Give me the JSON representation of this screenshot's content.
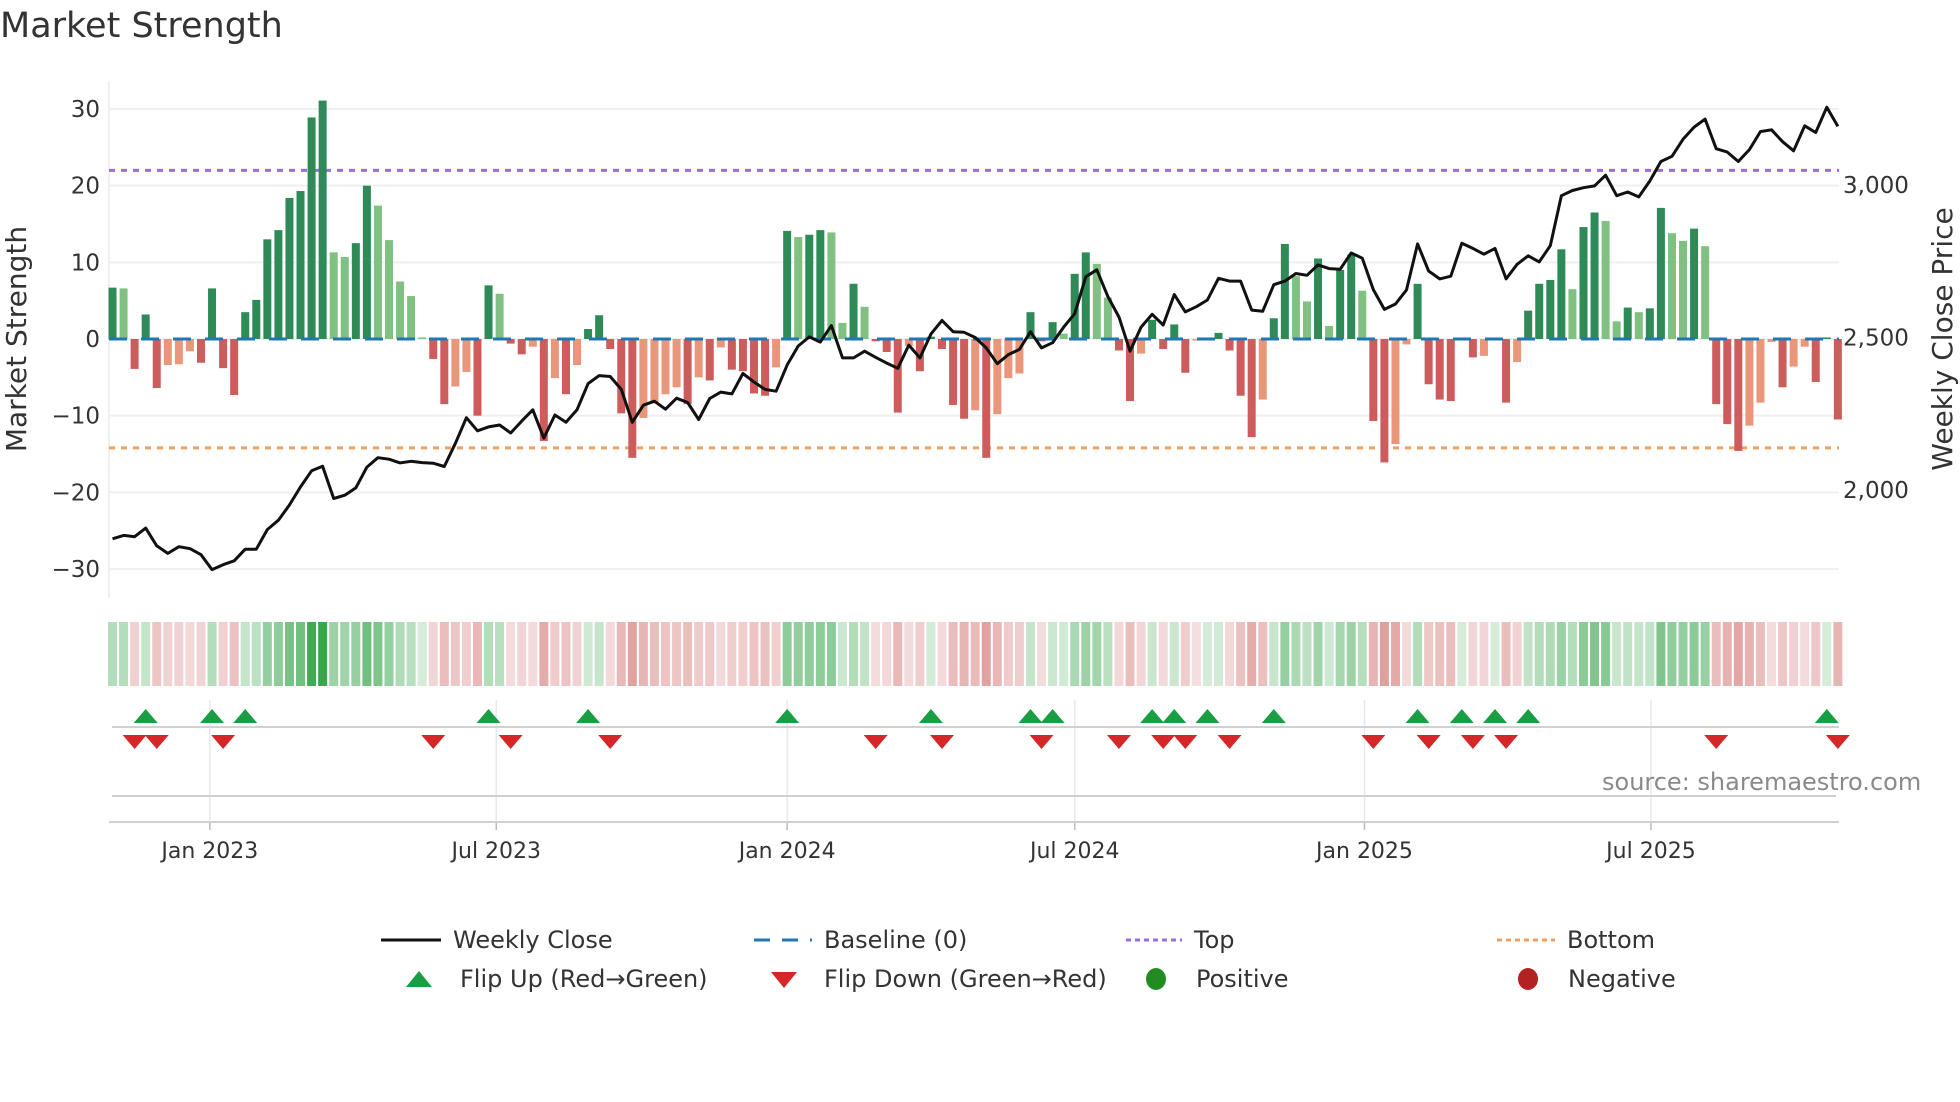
{
  "title": "Market Strength",
  "source": "source: sharemaestro.com",
  "legend": {
    "weekly_close": "Weekly Close",
    "baseline": "Baseline (0)",
    "top": "Top",
    "bottom": "Bottom",
    "flip_up": "Flip Up (Red→Green)",
    "flip_down": "Flip Down (Green→Red)",
    "positive": "Positive",
    "negative": "Negative"
  },
  "colors": {
    "green_dark": "#2e8b57",
    "green_light": "#80c080",
    "red_dark": "#cd5c5c",
    "red_light": "#e9967a",
    "baseline": "#1f77b4",
    "top": "#9b6ddb",
    "bottom": "#f0a060",
    "flip_up": "#1a9e44",
    "flip_down": "#d62728",
    "positive": "#228b22",
    "negative": "#b22222"
  },
  "chart_data": {
    "type": "bar",
    "title": "Market Strength",
    "ylabel": "Market Strength",
    "y2label": "Weekly Close Price",
    "ylim": [
      -33.5,
      33.5
    ],
    "yticks": [
      30,
      20,
      10,
      0,
      -10,
      -20,
      -30
    ],
    "yticklabels": [
      "30",
      "20",
      "10",
      "0",
      "−10",
      "−20",
      "−30"
    ],
    "y2ticks": [
      3000,
      2500,
      2000
    ],
    "y2ticklabels": [
      "3,000",
      "2,500",
      "2,000"
    ],
    "top_level": 22.0,
    "bottom_level": -14.2,
    "baseline": 0,
    "x_unit": "week index",
    "xticks": [
      9.8,
      35.7,
      62.0,
      88.0,
      114.2,
      140.1
    ],
    "xticklabels": [
      "Jan 2023",
      "Jul 2023",
      "Jan 2024",
      "Jul 2024",
      "Jan 2025",
      "Jul 2025"
    ],
    "strength": [
      6.7,
      6.6,
      -3.9,
      3.2,
      -6.4,
      -3.4,
      -3.3,
      -1.6,
      -3.1,
      6.6,
      -3.8,
      -7.3,
      3.5,
      5.1,
      13.0,
      14.2,
      18.4,
      19.3,
      28.9,
      31.1,
      11.3,
      10.7,
      12.5,
      20.0,
      17.4,
      12.9,
      7.5,
      5.6,
      0.2,
      -2.6,
      -8.5,
      -6.2,
      -4.3,
      -10.0,
      7.0,
      5.9,
      -0.6,
      -2.0,
      -1.0,
      -13.3,
      -5.1,
      -7.2,
      -3.4,
      1.3,
      3.1,
      -1.3,
      -9.7,
      -15.5,
      -10.3,
      -8.4,
      -7.2,
      -6.3,
      -8.5,
      -5.0,
      -5.4,
      -1.1,
      -4.0,
      -4.2,
      -7.1,
      -7.4,
      -3.7,
      14.1,
      13.3,
      13.6,
      14.2,
      13.9,
      2.1,
      7.2,
      4.2,
      -0.3,
      -1.7,
      -9.6,
      -0.9,
      -4.2,
      0.3,
      -1.3,
      -8.6,
      -10.4,
      -9.3,
      -15.5,
      -9.8,
      -5.1,
      -4.5,
      3.5,
      -0.3,
      2.2,
      0.7,
      8.5,
      11.3,
      9.8,
      5.4,
      -1.5,
      -8.1,
      -1.9,
      2.5,
      -1.3,
      1.9,
      -4.4,
      -0.2,
      0.2,
      0.8,
      -1.5,
      -7.4,
      -12.8,
      -7.9,
      2.7,
      12.4,
      8.2,
      4.9,
      10.5,
      1.7,
      9.0,
      11.0,
      6.3,
      -10.7,
      -16.1,
      -13.7,
      -0.7,
      7.2,
      -5.9,
      -7.9,
      -8.1,
      0.2,
      -2.4,
      -2.2,
      0.2,
      -8.3,
      -3.0,
      3.7,
      7.2,
      7.7,
      11.7,
      6.5,
      14.6,
      16.5,
      15.4,
      2.3,
      4.1,
      3.5,
      4.0,
      17.1,
      13.8,
      12.8,
      14.4,
      12.1,
      -8.5,
      -11.1,
      -14.6,
      -11.3,
      -8.3,
      -0.4,
      -6.3,
      -3.6,
      -1.0,
      -5.6,
      0.2,
      -10.5
    ],
    "weekly_close": [
      1840,
      1851,
      1847,
      1875,
      1817,
      1792,
      1814,
      1808,
      1788,
      1739,
      1755,
      1768,
      1806,
      1806,
      1870,
      1901,
      1951,
      2010,
      2063,
      2078,
      1972,
      1983,
      2007,
      2075,
      2106,
      2101,
      2089,
      2094,
      2090,
      2088,
      2077,
      2153,
      2237,
      2194,
      2207,
      2213,
      2187,
      2226,
      2263,
      2170,
      2246,
      2222,
      2263,
      2349,
      2375,
      2372,
      2330,
      2222,
      2278,
      2291,
      2265,
      2301,
      2287,
      2231,
      2300,
      2321,
      2315,
      2382,
      2354,
      2330,
      2324,
      2410,
      2472,
      2502,
      2485,
      2539,
      2433,
      2433,
      2455,
      2435,
      2416,
      2399,
      2475,
      2433,
      2511,
      2556,
      2519,
      2517,
      2500,
      2466,
      2414,
      2444,
      2461,
      2519,
      2466,
      2483,
      2534,
      2578,
      2699,
      2722,
      2634,
      2567,
      2455,
      2534,
      2576,
      2541,
      2641,
      2584,
      2601,
      2623,
      2694,
      2685,
      2685,
      2590,
      2586,
      2673,
      2685,
      2710,
      2704,
      2738,
      2726,
      2724,
      2777,
      2760,
      2657,
      2592,
      2610,
      2656,
      2807,
      2718,
      2692,
      2701,
      2809,
      2792,
      2773,
      2792,
      2692,
      2740,
      2768,
      2748,
      2801,
      2965,
      2982,
      2991,
      2997,
      3032,
      2965,
      2977,
      2961,
      3013,
      3077,
      3094,
      3150,
      3190,
      3216,
      3119,
      3108,
      3077,
      3116,
      3175,
      3181,
      3142,
      3112,
      3194,
      3172,
      3255,
      3192
    ]
  }
}
